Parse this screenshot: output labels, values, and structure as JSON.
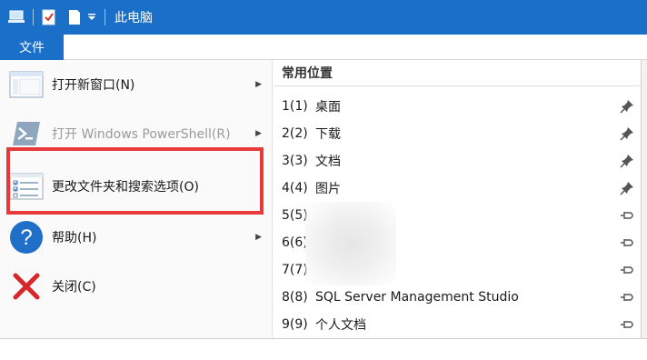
{
  "titlebar": {
    "title": "此电脑",
    "accent": "#1a6fc9"
  },
  "ribbon": {
    "file_tab": "文件"
  },
  "menu": {
    "items": [
      {
        "label": "打开新窗口(N)",
        "icon": "new-window-icon",
        "submenu": true,
        "enabled": true
      },
      {
        "label": "打开 Windows PowerShell(R)",
        "icon": "powershell-icon",
        "submenu": true,
        "enabled": false
      },
      {
        "label": "更改文件夹和搜索选项(O)",
        "icon": "folder-options-icon",
        "submenu": false,
        "enabled": true
      },
      {
        "label": "帮助(H)",
        "icon": "help-icon",
        "submenu": true,
        "enabled": true
      },
      {
        "label": "关闭(C)",
        "icon": "close-icon",
        "submenu": false,
        "enabled": true
      }
    ],
    "highlight_color": "#e8393b"
  },
  "frequent": {
    "title": "常用位置",
    "items": [
      {
        "num": "1(1)",
        "name": "桌面",
        "pinned": true
      },
      {
        "num": "2(2)",
        "name": "下载",
        "pinned": true
      },
      {
        "num": "3(3)",
        "name": "文档",
        "pinned": true
      },
      {
        "num": "4(4)",
        "name": "图片",
        "pinned": true
      },
      {
        "num": "5(5)",
        "name": "",
        "pinned": false
      },
      {
        "num": "6(6)",
        "name": "",
        "pinned": false
      },
      {
        "num": "7(7)",
        "name": "",
        "pinned": false
      },
      {
        "num": "8(8)",
        "name": "SQL Server Management Studio",
        "pinned": false
      },
      {
        "num": "9(9)",
        "name": "个人文档",
        "pinned": false
      }
    ]
  }
}
